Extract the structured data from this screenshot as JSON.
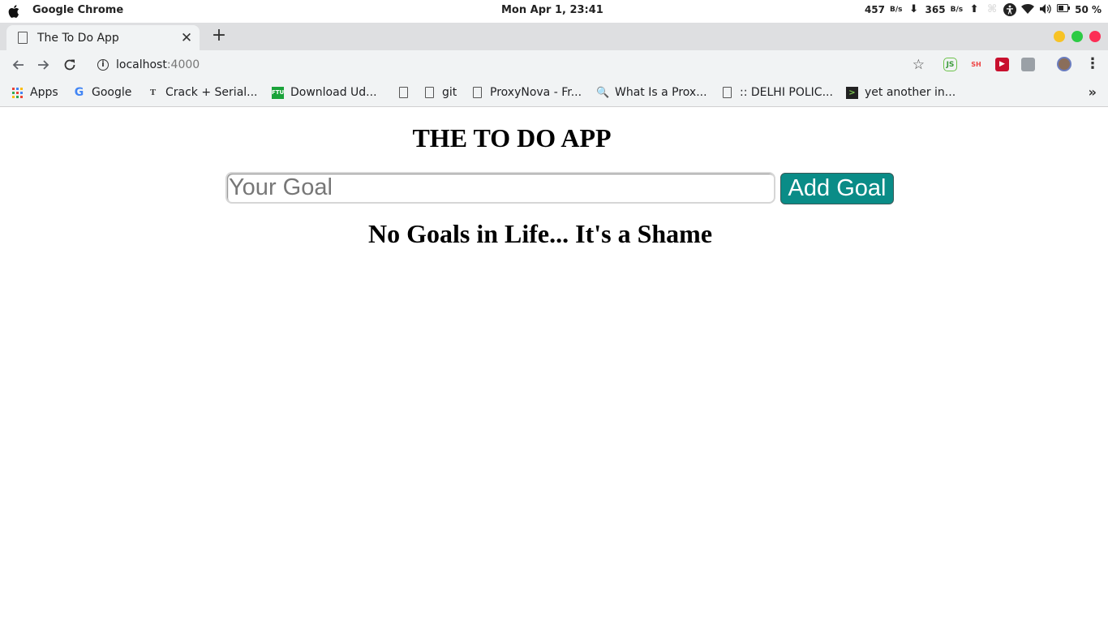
{
  "os": {
    "app_name": "Google Chrome",
    "clock": "Mon Apr  1, 23:41",
    "net_down_value": "457",
    "net_down_unit": "B/s",
    "net_up_value": "365",
    "net_up_unit": "B/s",
    "battery": "50 %"
  },
  "browser": {
    "tab_title": "The To Do App",
    "url_host": "localhost",
    "url_port": ":4000",
    "bookmarks": [
      {
        "label": "Apps"
      },
      {
        "label": "Google"
      },
      {
        "label": "Crack + Serial..."
      },
      {
        "label": "Download Ud..."
      },
      {
        "label": ""
      },
      {
        "label": "git"
      },
      {
        "label": "ProxyNova - Fr..."
      },
      {
        "label": "What Is a Prox..."
      },
      {
        "label": ":: DELHI POLIC..."
      },
      {
        "label": "yet another in..."
      }
    ],
    "ext_badges": [
      "JS",
      "SH"
    ]
  },
  "app": {
    "title": "THE TO DO APP",
    "input_placeholder": "Your Goal",
    "input_value": "",
    "add_button": "Add Goal",
    "empty_message": "No Goals in Life... It's a Shame"
  },
  "colors": {
    "add_button_bg": "#0a8c87",
    "win_minimize": "#f7c325",
    "win_maximize": "#2dcb45",
    "win_close": "#fc2d55"
  }
}
